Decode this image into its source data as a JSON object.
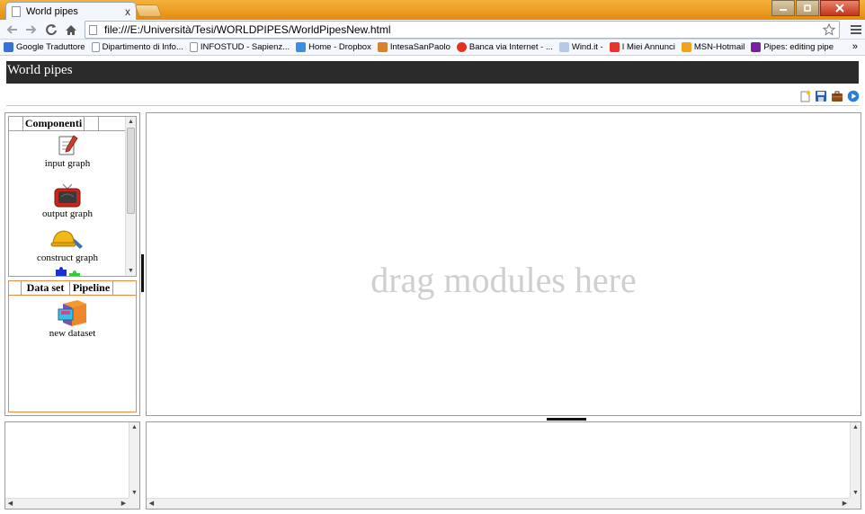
{
  "browser": {
    "tab_title": "World pipes",
    "tab_close": "x",
    "url": "file:///E:/Università/Tesi/WORLDPIPES/WorldPipesNew.html",
    "bookmarks": [
      {
        "label": "Google Traduttore",
        "icon": "google-translate-icon",
        "color": "#3b6fd8"
      },
      {
        "label": "Dipartimento di Info...",
        "icon": "page-icon",
        "color": "#dddddd"
      },
      {
        "label": "INFOSTUD - Sapienz...",
        "icon": "page-icon",
        "color": "#dddddd"
      },
      {
        "label": "Home - Dropbox",
        "icon": "dropbox-icon",
        "color": "#3a8ee6"
      },
      {
        "label": "IntesaSanPaolo",
        "icon": "intesa-icon",
        "color": "#d9822b"
      },
      {
        "label": "Banca via Internet - ...",
        "icon": "no-entry-icon",
        "color": "#e0341e"
      },
      {
        "label": "Wind.it -",
        "icon": "wind-icon",
        "color": "#b6c9e6"
      },
      {
        "label": "I Miei Annunci",
        "icon": "ebay-icon",
        "color": "#e8342a"
      },
      {
        "label": "MSN-Hotmail",
        "icon": "msn-butterfly-icon",
        "color": "#f2a11c"
      },
      {
        "label": "Pipes: editing pipe",
        "icon": "yahoo-icon",
        "color": "#7b1fa2"
      }
    ],
    "bookmarks_more": "»"
  },
  "app": {
    "title": "World pipes",
    "components_panel": {
      "tab_label": "Componenti",
      "modules": [
        {
          "label": "input graph",
          "icon": "notepad-pencil-icon"
        },
        {
          "label": "output graph",
          "icon": "tv-icon"
        },
        {
          "label": "construct graph",
          "icon": "hard-hat-icon"
        },
        {
          "label": "",
          "icon": "puzzle-pieces-icon"
        }
      ]
    },
    "dataset_panel": {
      "tabs": [
        "Data set",
        "Pipeline"
      ],
      "modules": [
        {
          "label": "new dataset",
          "icon": "file-cabinet-icon"
        }
      ]
    },
    "canvas": {
      "placeholder": "drag modules here"
    },
    "colors": {
      "header_bg": "#2b2b2b",
      "panel_border": "#ee8a40",
      "placeholder_text": "#cfcfcf"
    }
  }
}
